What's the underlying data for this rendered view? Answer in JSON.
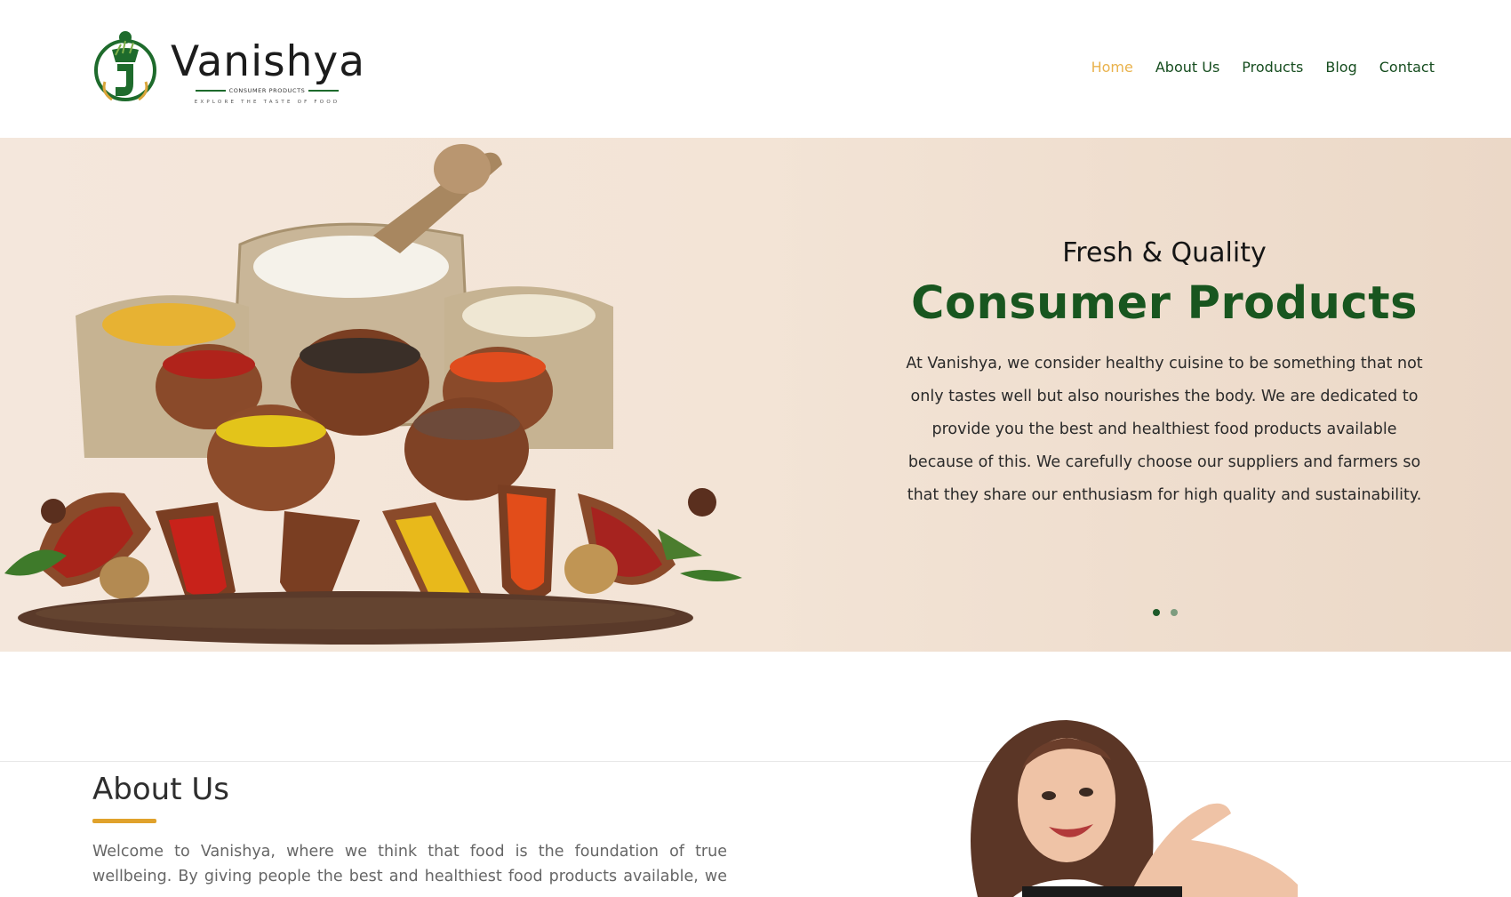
{
  "brand": {
    "name": "Vanishya",
    "subtitle": "CONSUMER PRODUCTS",
    "tagline": "EXPLORE THE TASTE OF FOOD",
    "green": "#1e6b2c",
    "gold": "#e0a22c"
  },
  "nav": {
    "items": [
      {
        "label": "Home",
        "active": true
      },
      {
        "label": "About Us",
        "active": false
      },
      {
        "label": "Products",
        "active": false
      },
      {
        "label": "Blog",
        "active": false
      },
      {
        "label": "Contact",
        "active": false
      }
    ]
  },
  "hero": {
    "kicker": "Fresh & Quality",
    "title": "Consumer Products",
    "body": "At Vanishya, we consider healthy cuisine to be something that not only tastes well but also nourishes the body. We are dedicated to provide you the best and healthiest food products available because of this. We carefully choose our suppliers and farmers so that they share our enthusiasm for high quality and sustainability.",
    "slides": 2,
    "active_slide": 1
  },
  "about": {
    "title": "About Us",
    "body": "Welcome to Vanishya, where we think that food is the foundation of true wellbeing. By giving people the best and healthiest food products available, we are"
  }
}
